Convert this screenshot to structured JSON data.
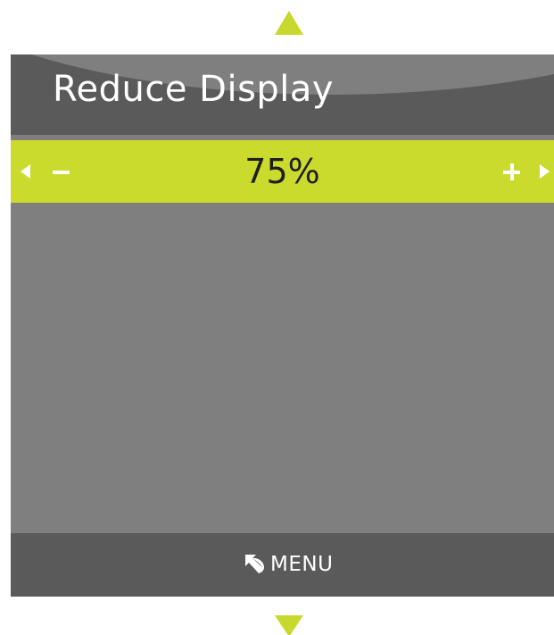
{
  "screen": {
    "title": "Reduce Display"
  },
  "setting": {
    "value": "75%",
    "level_percent": 75
  },
  "footer": {
    "menu_label": "MENU"
  },
  "icons": {
    "nav_up": "triangle-up-icon",
    "nav_down": "triangle-down-icon",
    "decrease_arrow": "triangle-left-icon",
    "increase_arrow": "triangle-right-icon",
    "decrease": "minus-icon",
    "increase": "plus-icon",
    "back": "return-arrow-icon"
  },
  "colors": {
    "accent": "#cbdb2d",
    "panel": "#7f7f7f",
    "bars": "#5a5a5a",
    "text_light": "#ffffff",
    "text_dark": "#1f1f1f"
  }
}
